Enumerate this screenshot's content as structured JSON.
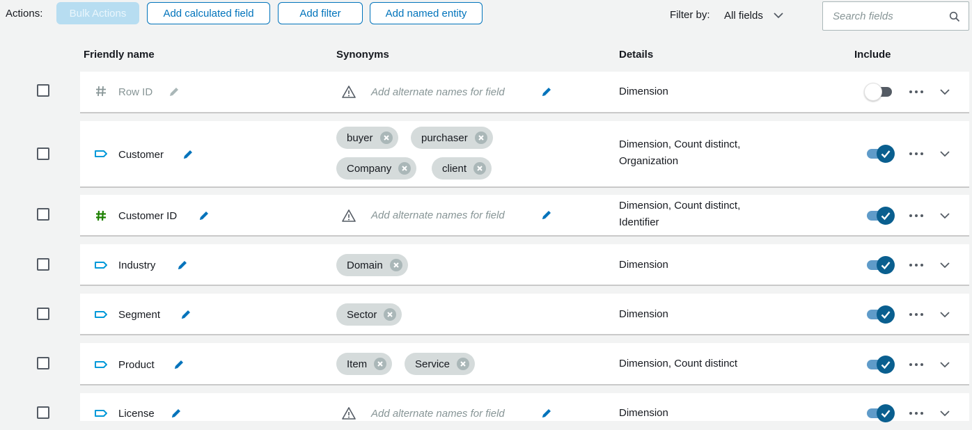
{
  "toolbar": {
    "actions_label": "Actions:",
    "bulk_actions": "Bulk Actions",
    "add_calculated_field": "Add calculated field",
    "add_filter": "Add filter",
    "add_named_entity": "Add named entity",
    "filter_by_label": "Filter by:",
    "filter_by_value": "All fields",
    "search_placeholder": "Search fields"
  },
  "columns": {
    "friendly_name": "Friendly name",
    "synonyms": "Synonyms",
    "details": "Details",
    "include": "Include"
  },
  "synonym_placeholder": "Add alternate names for field",
  "colors": {
    "accent": "#0073bb",
    "dimension_icon": "#0099d9",
    "measure_icon": "#1d8102",
    "chip_bg": "#d5dbdb",
    "toggle_on": "#0a5f8f"
  },
  "rows": [
    {
      "name": "Row ID",
      "type_icon": "hash-icon",
      "muted": true,
      "synonyms": [],
      "details": [
        "Dimension"
      ],
      "include": false
    },
    {
      "name": "Customer",
      "type_icon": "tag-icon",
      "synonyms": [
        "buyer",
        "purchaser",
        "Company",
        "client"
      ],
      "details": [
        "Dimension, Count distinct,",
        "Organization"
      ],
      "include": true
    },
    {
      "name": "Customer ID",
      "type_icon": "hash-icon",
      "synonyms": [],
      "details": [
        "Dimension, Count distinct,",
        "Identifier"
      ],
      "include": true
    },
    {
      "name": "Industry",
      "type_icon": "tag-icon",
      "synonyms": [
        "Domain"
      ],
      "details": [
        "Dimension"
      ],
      "include": true
    },
    {
      "name": "Segment",
      "type_icon": "tag-icon",
      "synonyms": [
        "Sector"
      ],
      "details": [
        "Dimension"
      ],
      "include": true
    },
    {
      "name": "Product",
      "type_icon": "tag-icon",
      "synonyms": [
        "Item",
        "Service"
      ],
      "details": [
        "Dimension, Count distinct"
      ],
      "include": true
    },
    {
      "name": "License",
      "type_icon": "tag-icon",
      "synonyms": [],
      "details": [
        "Dimension"
      ],
      "include": true
    }
  ]
}
